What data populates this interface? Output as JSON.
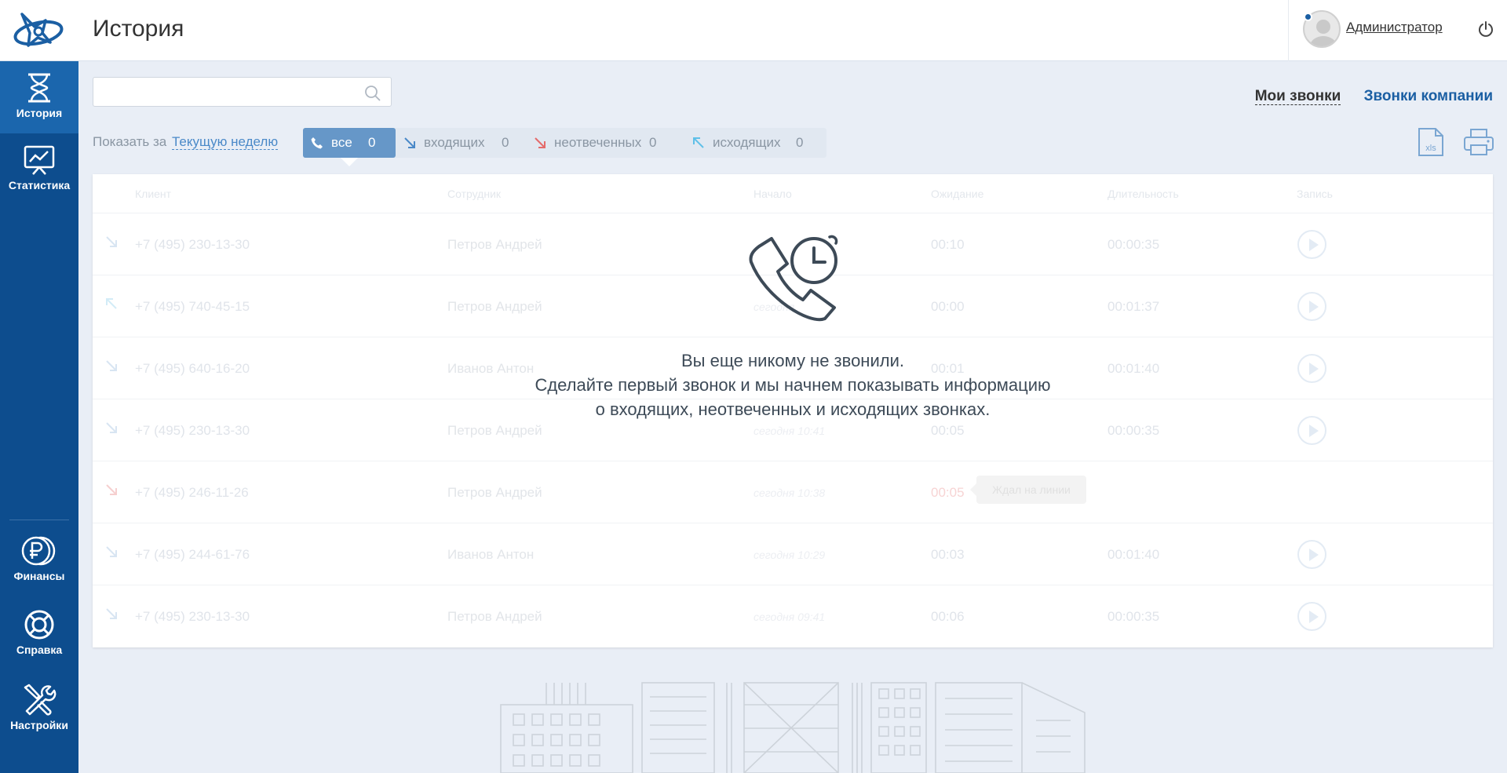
{
  "header": {
    "title": "История",
    "user_name": "Администратор"
  },
  "sidebar": {
    "items": [
      {
        "label": "История",
        "icon": "hourglass-icon",
        "active": true
      },
      {
        "label": "Статистика",
        "icon": "chart-board-icon",
        "active": false
      },
      {
        "label": "Финансы",
        "icon": "ruble-icon",
        "active": false
      },
      {
        "label": "Справка",
        "icon": "lifebuoy-icon",
        "active": false
      },
      {
        "label": "Настройки",
        "icon": "tools-icon",
        "active": false
      }
    ]
  },
  "search": {
    "value": "",
    "placeholder": ""
  },
  "scope_tabs": {
    "my": "Мои звонки",
    "company": "Звонки компании"
  },
  "period": {
    "label": "Показать за",
    "value": "Текущую неделю"
  },
  "filters": [
    {
      "label": "все",
      "count": "0",
      "active": true
    },
    {
      "label": "входящих",
      "count": "0",
      "active": false
    },
    {
      "label": "неотвеченных",
      "count": "0",
      "active": false
    },
    {
      "label": "исходящих",
      "count": "0",
      "active": false
    }
  ],
  "table": {
    "headers": {
      "client": "Клиент",
      "employee": "Сотрудник",
      "start": "Начало",
      "wait": "Ожидание",
      "duration": "Длительность",
      "record": "Запись"
    },
    "rows": [
      {
        "direction": "incoming",
        "client": "+7 (495) 230-13-30",
        "employee": "Петров Андрей",
        "start": "",
        "wait": "00:10",
        "duration": "00:00:35",
        "record": true
      },
      {
        "direction": "outgoing",
        "client": "+7 (495) 740-45-15",
        "employee": "Петров Андрей",
        "start": "сегодня",
        "wait": "00:00",
        "duration": "00:01:37",
        "record": true
      },
      {
        "direction": "incoming",
        "client": "+7 (495) 640-16-20",
        "employee": "Иванов Антон",
        "start": "",
        "wait": "00:01",
        "duration": "00:01:40",
        "record": true
      },
      {
        "direction": "incoming",
        "client": "+7 (495) 230-13-30",
        "employee": "Петров Андрей",
        "start": "сегодня 10:41",
        "wait": "00:05",
        "duration": "00:00:35",
        "record": true
      },
      {
        "direction": "missed",
        "client": "+7 (495) 246-11-26",
        "employee": "Петров Андрей",
        "start": "сегодня 10:38",
        "wait": "00:05",
        "duration": "",
        "record": false,
        "note": "Ждал на линии"
      },
      {
        "direction": "incoming",
        "client": "+7 (495) 244-61-76",
        "employee": "Иванов Антон",
        "start": "сегодня 10:29",
        "wait": "00:03",
        "duration": "00:01:40",
        "record": true
      },
      {
        "direction": "incoming",
        "client": "+7 (495) 230-13-30",
        "employee": "Петров Андрей",
        "start": "сегодня 09:41",
        "wait": "00:06",
        "duration": "00:00:35",
        "record": true
      }
    ]
  },
  "empty_state": {
    "line1": "Вы еще никому не звонили.",
    "line2": "Сделайте первый звонок и мы начнем показывать информацию",
    "line3": "о входящих, неотвеченных и исходящих звонках."
  },
  "export": {
    "xls_label": "xls"
  },
  "colors": {
    "sidebar": "#0d4d8e",
    "sidebar_active": "#1b66ad",
    "accent": "#1b5fa3",
    "filter_active": "#6697c8",
    "missed": "#e46b6b",
    "incoming": "#4a89c8",
    "outgoing": "#5fc0e8"
  }
}
